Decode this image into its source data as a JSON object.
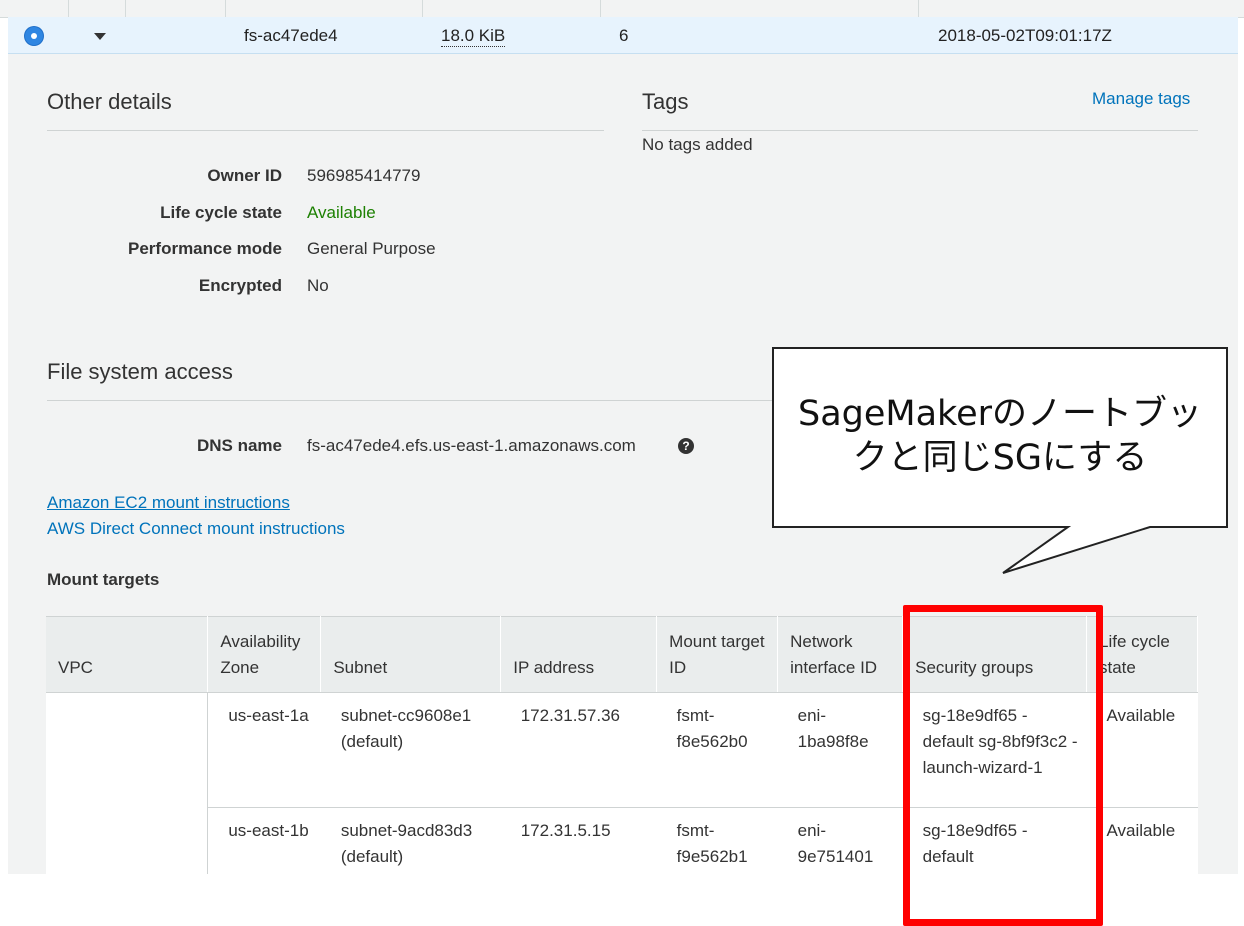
{
  "fs_row": {
    "name": "fs-ac47ede4",
    "size": "18.0 KiB",
    "mount_targets_count": "6",
    "creation_time": "2018-05-02T09:01:17Z"
  },
  "other_details": {
    "title": "Other details",
    "fields": [
      {
        "label": "Owner ID",
        "value": "596985414779"
      },
      {
        "label": "Life cycle state",
        "value": "Available"
      },
      {
        "label": "Performance mode",
        "value": "General Purpose"
      },
      {
        "label": "Encrypted",
        "value": "No"
      }
    ]
  },
  "tags": {
    "title": "Tags",
    "manage_link": "Manage tags",
    "empty_text": "No tags added"
  },
  "file_system_access": {
    "title": "File system access",
    "dns_label": "DNS name",
    "dns_value": "fs-ac47ede4.efs.us-east-1.amazonaws.com",
    "help_icon": "question-circle-icon",
    "ec2_link": "Amazon EC2 mount instructions",
    "direct_connect_link": "AWS Direct Connect mount instructions"
  },
  "mount_targets": {
    "title": "Mount targets",
    "columns": [
      "VPC",
      "Availability Zone",
      "Subnet",
      "IP address",
      "Mount target ID",
      "Network interface ID",
      "Security groups",
      "Life cycle state"
    ],
    "rows": [
      {
        "vpc": "",
        "az": "us-east-1a",
        "subnet": "subnet-cc9608e1 (default)",
        "ip": "172.31.57.36",
        "mount_target_id": "fsmt-f8e562b0",
        "eni": "eni-1ba98f8e",
        "security_groups": "sg-18e9df65 - default sg-8bf9f3c2 - launch-wizard-1",
        "state": "Available"
      },
      {
        "vpc": "",
        "az": "us-east-1b",
        "subnet": "subnet-9acd83d3 (default)",
        "ip": "172.31.5.15",
        "mount_target_id": "fsmt-f9e562b1",
        "eni": "eni-9e751401",
        "security_groups": "sg-18e9df65 - default",
        "state": "Available"
      }
    ]
  },
  "annotation": {
    "line1": "SageMakerのノートブッ",
    "line2": "クと同じSGにする",
    "highlight_color": "#ff0000"
  },
  "colors": {
    "link": "#0073bb",
    "available": "#1d8102",
    "selected_row": "#e7f3fd",
    "panel_bg": "#f2f3f3"
  }
}
